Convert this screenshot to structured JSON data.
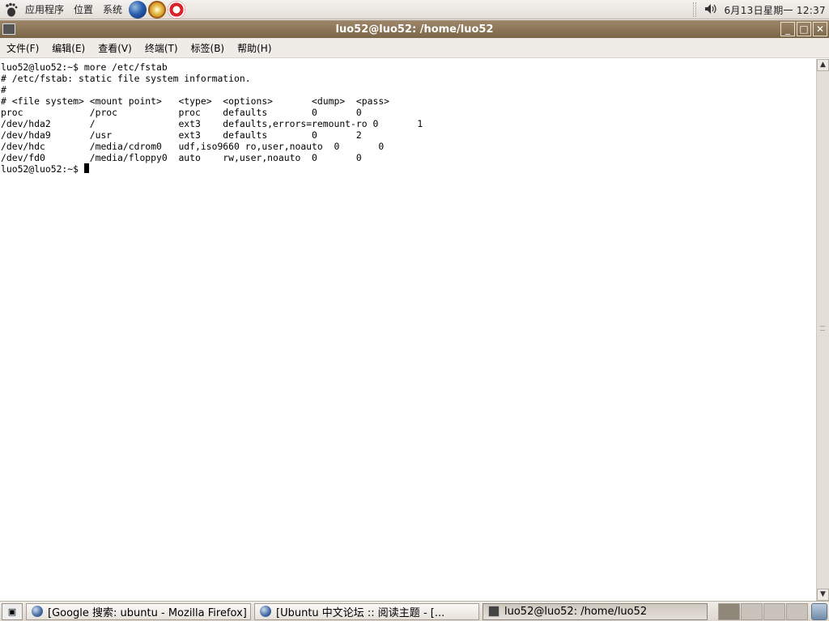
{
  "top_panel": {
    "menus": [
      "应用程序",
      "位置",
      "系统"
    ],
    "clock": "6月13日星期一 12:37"
  },
  "window": {
    "title": "luo52@luo52: /home/luo52",
    "menubar": [
      "文件(F)",
      "编辑(E)",
      "查看(V)",
      "终端(T)",
      "标签(B)",
      "帮助(H)"
    ]
  },
  "terminal": {
    "lines": [
      "luo52@luo52:~$ more /etc/fstab",
      "# /etc/fstab: static file system information.",
      "#",
      "# <file system> <mount point>   <type>  <options>       <dump>  <pass>",
      "proc            /proc           proc    defaults        0       0",
      "/dev/hda2       /               ext3    defaults,errors=remount-ro 0       1",
      "/dev/hda9       /usr            ext3    defaults        0       2",
      "/dev/hdc        /media/cdrom0   udf,iso9660 ro,user,noauto  0       0",
      "/dev/fd0        /media/floppy0  auto    rw,user,noauto  0       0"
    ],
    "prompt": "luo52@luo52:~$ "
  },
  "taskbar": {
    "tasks": [
      "[Google 搜索: ubuntu - Mozilla Firefox]",
      "[Ubuntu 中文论坛 :: 阅读主题 - [...",
      "luo52@luo52: /home/luo52"
    ]
  }
}
